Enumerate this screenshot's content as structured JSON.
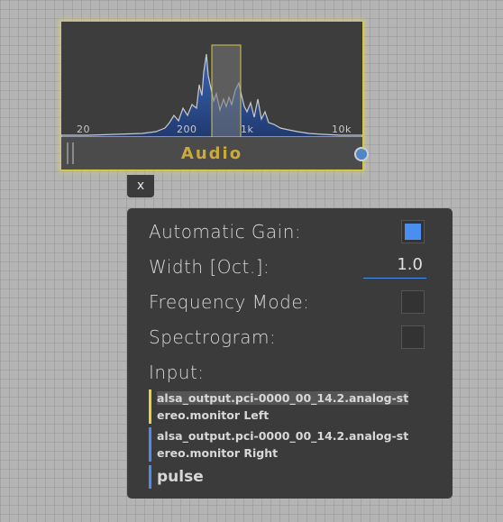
{
  "node": {
    "title": "Audio",
    "freq_labels": [
      "20",
      "200",
      "1k",
      "10k"
    ]
  },
  "close_label": "x",
  "panel": {
    "automatic_gain_label": "Automatic Gain:",
    "automatic_gain_checked": true,
    "width_label": "Width [Oct.]:",
    "width_value": "1.0",
    "frequency_mode_label": "Frequency Mode:",
    "frequency_mode_checked": false,
    "spectrogram_label": "Spectrogram:",
    "spectrogram_checked": false,
    "input_label": "Input:",
    "sources": [
      {
        "line1": "alsa_output.pci-0000_00_14.2.analog-st",
        "line2": "ereo.monitor Left",
        "selected": true
      },
      {
        "line1": "alsa_output.pci-0000_00_14.2.analog-st",
        "line2": "ereo.monitor Right",
        "selected": false
      },
      {
        "line1": "pulse",
        "line2": "",
        "selected": false
      }
    ]
  },
  "colors": {
    "accent": "#4a8ff0",
    "node_border": "#d6c84a",
    "title": "#c9aa3a",
    "selected_marker": "#e8d437"
  }
}
